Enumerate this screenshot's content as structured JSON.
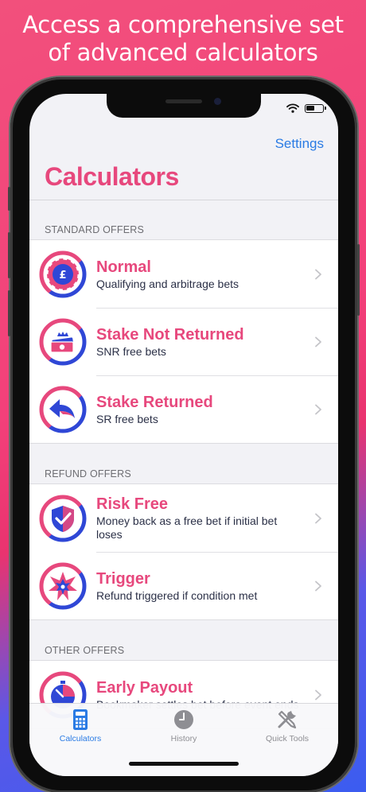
{
  "banner": {
    "line1": "Access a comprehensive set",
    "line2": "of advanced calculators"
  },
  "header": {
    "settings_label": "Settings",
    "title": "Calculators"
  },
  "sections": {
    "standard": {
      "header": "STANDARD OFFERS",
      "items": [
        {
          "title": "Normal",
          "subtitle": "Qualifying and arbitrage bets",
          "icon": "poker-chip-icon"
        },
        {
          "title": "Stake Not Returned",
          "subtitle": "SNR free bets",
          "icon": "cash-stack-icon"
        },
        {
          "title": "Stake Returned",
          "subtitle": "SR free bets",
          "icon": "return-arrow-icon"
        }
      ]
    },
    "refund": {
      "header": "REFUND OFFERS",
      "items": [
        {
          "title": "Risk Free",
          "subtitle": "Money back as a free bet if initial bet loses",
          "icon": "shield-check-icon"
        },
        {
          "title": "Trigger",
          "subtitle": "Refund triggered if condition met",
          "icon": "burst-icon"
        }
      ]
    },
    "other": {
      "header": "OTHER OFFERS",
      "items": [
        {
          "title": "Early Payout",
          "subtitle": "Bookmaker settles bet before event ends",
          "icon": "stopwatch-icon"
        }
      ]
    }
  },
  "tabbar": {
    "tabs": [
      {
        "label": "Calculators",
        "icon": "calculator-icon",
        "active": true
      },
      {
        "label": "History",
        "icon": "clock-icon",
        "active": false
      },
      {
        "label": "Quick Tools",
        "icon": "tools-icon",
        "active": false
      }
    ]
  },
  "colors": {
    "accent": "#e7487d",
    "link": "#2a7be4",
    "icon_blue": "#2f47d6",
    "tab_active": "#2a7be4",
    "tab_inactive": "#8e8e93"
  }
}
